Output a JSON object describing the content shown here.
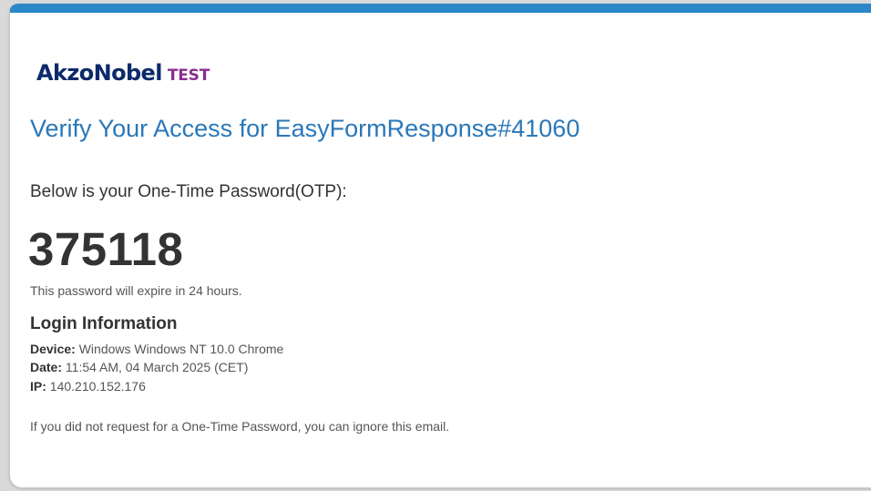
{
  "brand": {
    "name": "AkzoNobel",
    "environment": "TEST",
    "colors": {
      "brand_blue": "#0c2a6b",
      "env_purple": "#8a2c8f",
      "accent_blue": "#2b87c8",
      "title_blue": "#2a78b8"
    }
  },
  "email": {
    "title": "Verify Your Access for EasyFormResponse#41060",
    "otp_intro": "Below is your One-Time Password(OTP):",
    "otp_code": "375118",
    "expiry_note": "This password will expire in 24 hours.",
    "login_info": {
      "heading": "Login Information",
      "device_label": "Device:",
      "device_value": "Windows Windows NT 10.0 Chrome",
      "date_label": "Date:",
      "date_value": "11:54 AM, 04 March 2025 (CET)",
      "ip_label": "IP:",
      "ip_value": "140.210.152.176"
    },
    "ignore_note": "If you did not request for a One-Time Password, you can ignore this email."
  }
}
